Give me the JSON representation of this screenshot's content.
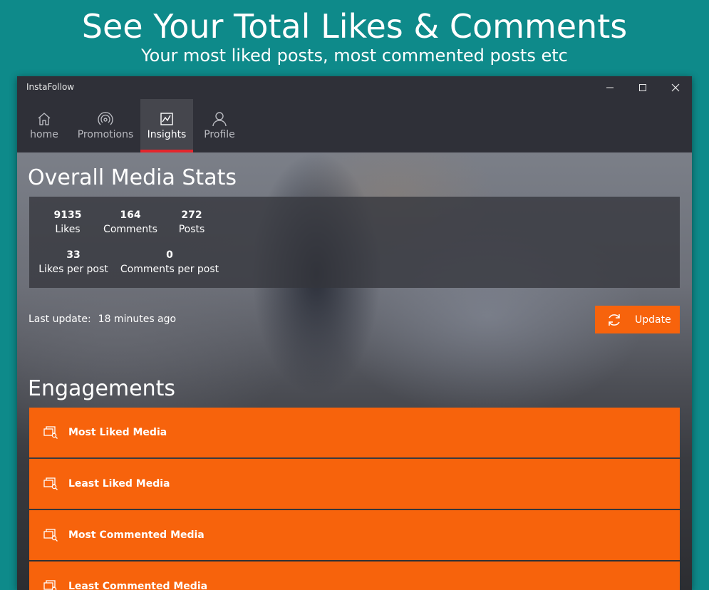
{
  "promo": {
    "title": "See Your Total Likes & Comments",
    "subtitle": "Your most liked posts, most commented posts etc"
  },
  "window": {
    "app_name": "InstaFollow",
    "controls": [
      "minimize-icon",
      "maximize-icon",
      "close-icon"
    ]
  },
  "nav": {
    "items": [
      {
        "label": "home",
        "icon": "home-icon",
        "active": false
      },
      {
        "label": "Promotions",
        "icon": "broadcast-icon",
        "active": false
      },
      {
        "label": "Insights",
        "icon": "chart-icon",
        "active": true
      },
      {
        "label": "Profile",
        "icon": "person-icon",
        "active": false
      }
    ],
    "active_color": "#e3262d"
  },
  "stats": {
    "title": "Overall Media Stats",
    "likes": {
      "value": "9135",
      "label": "Likes"
    },
    "comments": {
      "value": "164",
      "label": "Comments"
    },
    "posts": {
      "value": "272",
      "label": "Posts"
    },
    "likes_per_post": {
      "value": "33",
      "label": "Likes per post"
    },
    "comments_per_post": {
      "value": "0",
      "label": "Comments per post"
    }
  },
  "update": {
    "label": "Last update:",
    "time": "18 minutes ago",
    "button_label": "Update",
    "accent": "#f7630c"
  },
  "engagements": {
    "title": "Engagements",
    "items": [
      {
        "label": "Most Liked Media",
        "icon": "media-search-icon"
      },
      {
        "label": "Least Liked Media",
        "icon": "media-search-icon"
      },
      {
        "label": "Most Commented Media",
        "icon": "media-search-icon"
      },
      {
        "label": "Least Commented Media",
        "icon": "media-search-icon"
      }
    ]
  }
}
